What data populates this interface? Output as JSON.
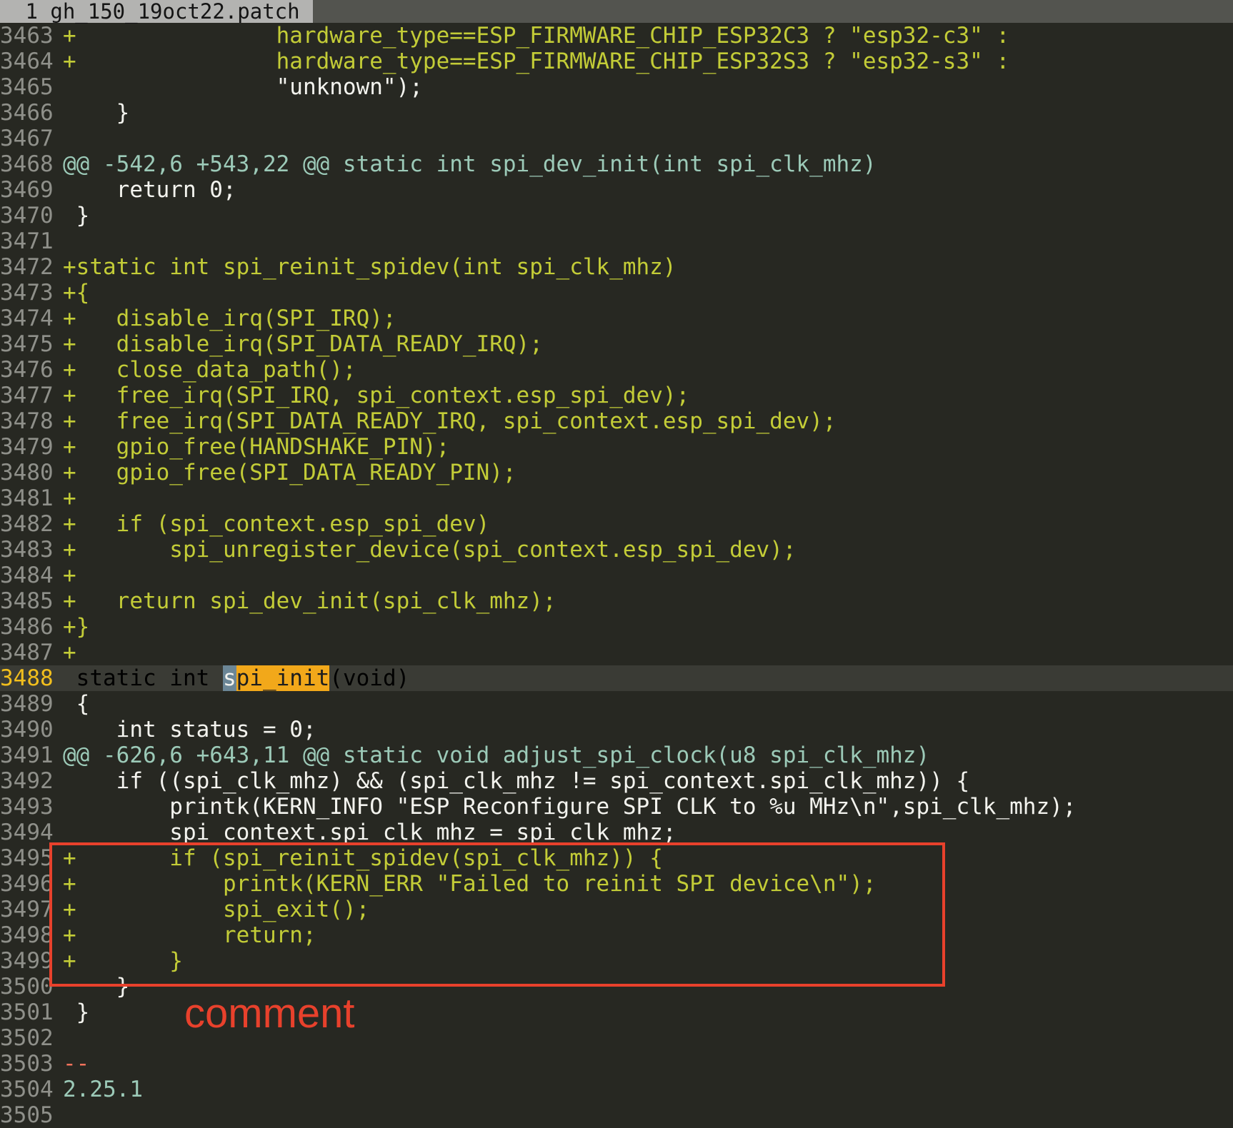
{
  "tab": {
    "title": " 1 gh_150_19oct22.patch"
  },
  "lines": [
    {
      "n": "3463",
      "t": "+               hardware_type==ESP_FIRMWARE_CHIP_ESP32C3 ? \"esp32-c3\" :",
      "k": "add"
    },
    {
      "n": "3464",
      "t": "+               hardware_type==ESP_FIRMWARE_CHIP_ESP32S3 ? \"esp32-s3\" :",
      "k": "add"
    },
    {
      "n": "3465",
      "t": "                \"unknown\");",
      "k": "ctx"
    },
    {
      "n": "3466",
      "t": "    }",
      "k": "ctx"
    },
    {
      "n": "3467",
      "t": "",
      "k": "ctx"
    },
    {
      "n": "3468",
      "t": "@@ -542,6 +543,22 @@ static int spi_dev_init(int spi_clk_mhz)",
      "k": "hunk"
    },
    {
      "n": "3469",
      "t": "    return 0;",
      "k": "ctx"
    },
    {
      "n": "3470",
      "t": " }",
      "k": "ctx"
    },
    {
      "n": "3471",
      "t": "",
      "k": "ctx"
    },
    {
      "n": "3472",
      "t": "+static int spi_reinit_spidev(int spi_clk_mhz)",
      "k": "add"
    },
    {
      "n": "3473",
      "t": "+{",
      "k": "add"
    },
    {
      "n": "3474",
      "t": "+   disable_irq(SPI_IRQ);",
      "k": "add"
    },
    {
      "n": "3475",
      "t": "+   disable_irq(SPI_DATA_READY_IRQ);",
      "k": "add"
    },
    {
      "n": "3476",
      "t": "+   close_data_path();",
      "k": "add"
    },
    {
      "n": "3477",
      "t": "+   free_irq(SPI_IRQ, spi_context.esp_spi_dev);",
      "k": "add"
    },
    {
      "n": "3478",
      "t": "+   free_irq(SPI_DATA_READY_IRQ, spi_context.esp_spi_dev);",
      "k": "add"
    },
    {
      "n": "3479",
      "t": "+   gpio_free(HANDSHAKE_PIN);",
      "k": "add"
    },
    {
      "n": "3480",
      "t": "+   gpio_free(SPI_DATA_READY_PIN);",
      "k": "add"
    },
    {
      "n": "3481",
      "t": "+",
      "k": "add"
    },
    {
      "n": "3482",
      "t": "+   if (spi_context.esp_spi_dev)",
      "k": "add"
    },
    {
      "n": "3483",
      "t": "+       spi_unregister_device(spi_context.esp_spi_dev);",
      "k": "add"
    },
    {
      "n": "3484",
      "t": "+",
      "k": "add"
    },
    {
      "n": "3485",
      "t": "+   return spi_dev_init(spi_clk_mhz);",
      "k": "add"
    },
    {
      "n": "3486",
      "t": "+}",
      "k": "add"
    },
    {
      "n": "3487",
      "t": "+",
      "k": "add"
    },
    {
      "n": "3488",
      "t": "",
      "k": "cur",
      "parts": [
        " static int ",
        "s",
        "pi_init",
        "(void)"
      ]
    },
    {
      "n": "3489",
      "t": " {",
      "k": "ctx"
    },
    {
      "n": "3490",
      "t": "    int status = 0;",
      "k": "ctx"
    },
    {
      "n": "3491",
      "t": "@@ -626,6 +643,11 @@ static void adjust_spi_clock(u8 spi_clk_mhz)",
      "k": "hunk"
    },
    {
      "n": "3492",
      "t": "    if ((spi_clk_mhz) && (spi_clk_mhz != spi_context.spi_clk_mhz)) {",
      "k": "ctx"
    },
    {
      "n": "3493",
      "t": "        printk(KERN_INFO \"ESP Reconfigure SPI CLK to %u MHz\\n\",spi_clk_mhz);",
      "k": "ctx"
    },
    {
      "n": "3494",
      "t": "        spi_context.spi_clk_mhz = spi_clk_mhz;",
      "k": "ctx"
    },
    {
      "n": "3495",
      "t": "+       if (spi_reinit_spidev(spi_clk_mhz)) {",
      "k": "add"
    },
    {
      "n": "3496",
      "t": "+           printk(KERN_ERR \"Failed to reinit SPI device\\n\");",
      "k": "add"
    },
    {
      "n": "3497",
      "t": "+           spi_exit();",
      "k": "add"
    },
    {
      "n": "3498",
      "t": "+           return;",
      "k": "add"
    },
    {
      "n": "3499",
      "t": "+       }",
      "k": "add"
    },
    {
      "n": "3500",
      "t": "    }",
      "k": "ctx"
    },
    {
      "n": "3501",
      "t": " }",
      "k": "ctx"
    },
    {
      "n": "3502",
      "t": "",
      "k": "ctx"
    },
    {
      "n": "3503",
      "t": "--",
      "k": "sep"
    },
    {
      "n": "3504",
      "t": "2.25.1",
      "k": "ver"
    },
    {
      "n": "3505",
      "t": "",
      "k": "ctx"
    }
  ],
  "annotation": {
    "label": "comment",
    "color": "#e8412c"
  }
}
